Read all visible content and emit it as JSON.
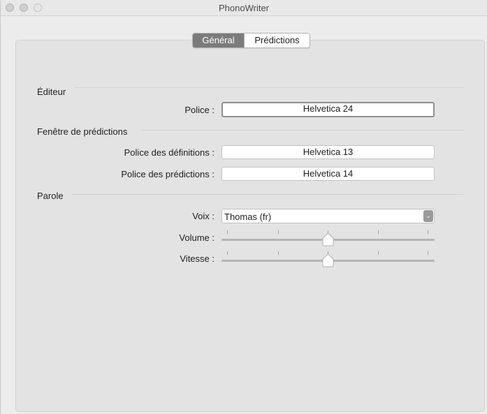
{
  "window": {
    "title": "PhonoWriter"
  },
  "tabs": [
    {
      "label": "Général",
      "selected": true
    },
    {
      "label": "Prédictions",
      "selected": false
    }
  ],
  "editor": {
    "section_title": "Éditeur",
    "font_label": "Police :",
    "font_value": "Helvetica 24"
  },
  "predictions_window": {
    "section_title": "Fenêtre de prédictions",
    "definitions_font_label": "Police des définitions :",
    "definitions_font_value": "Helvetica 13",
    "predictions_font_label": "Police des prédictions :",
    "predictions_font_value": "Helvetica 14"
  },
  "speech": {
    "section_title": "Parole",
    "voice_label": "Voix :",
    "voice_value": "Thomas (fr)",
    "volume_label": "Volume :",
    "volume_level": 0.5,
    "speed_label": "Vitesse :",
    "speed_level": 0.5,
    "slider_ticks": 5
  },
  "icons": {
    "popup_arrow": "chevron-down-icon"
  }
}
